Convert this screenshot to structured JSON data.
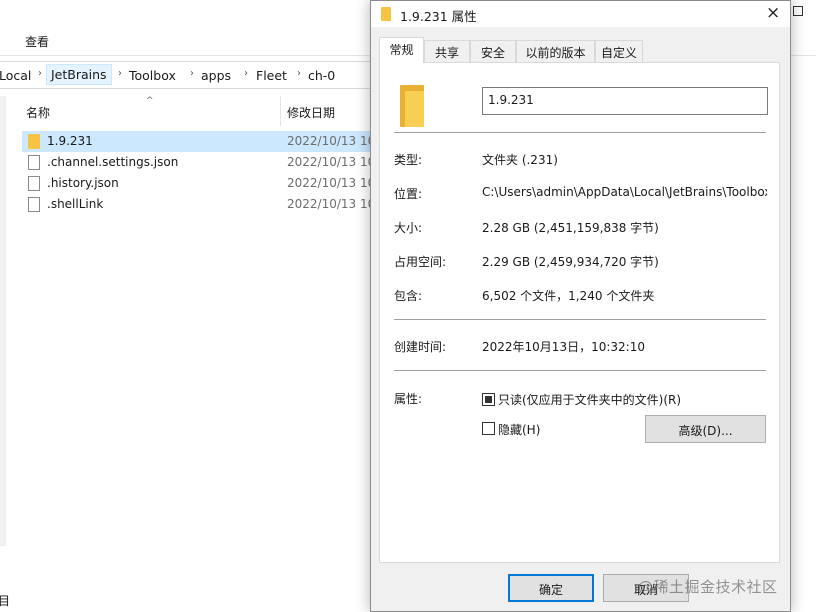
{
  "explorer": {
    "ribbon_tab": "查看",
    "breadcrumbs": [
      "Local",
      "JetBrains",
      "Toolbox",
      "apps",
      "Fleet",
      "ch-0"
    ],
    "columns": {
      "name": "名称",
      "modified": "修改日期"
    },
    "files": [
      {
        "name": "1.9.231",
        "date": "2022/10/13 10",
        "type": "folder",
        "selected": true
      },
      {
        "name": ".channel.settings.json",
        "date": "2022/10/13 10",
        "type": "json",
        "selected": false
      },
      {
        "name": ".history.json",
        "date": "2022/10/13 10",
        "type": "json",
        "selected": false
      },
      {
        "name": ".shellLink",
        "date": "2022/10/13 10",
        "type": "file",
        "selected": false
      }
    ],
    "status_glyph": "目"
  },
  "dialog": {
    "title": "1.9.231 属性",
    "close_label": "×",
    "tabs": [
      "常规",
      "共享",
      "安全",
      "以前的版本",
      "自定义"
    ],
    "active_tab": 0,
    "name_value": "1.9.231",
    "props": {
      "type": {
        "label": "类型:",
        "value": "文件夹 (.231)"
      },
      "location": {
        "label": "位置:",
        "value": "C:\\Users\\admin\\AppData\\Local\\JetBrains\\Toolbox"
      },
      "size": {
        "label": "大小:",
        "value": "2.28 GB (2,451,159,838 字节)"
      },
      "disk_size": {
        "label": "占用空间:",
        "value": "2.29 GB (2,459,934,720 字节)"
      },
      "contains": {
        "label": "包含:",
        "value": "6,502 个文件，1,240 个文件夹"
      },
      "created": {
        "label": "创建时间:",
        "value": "2022年10月13日，10:32:10"
      },
      "attributes": {
        "label": "属性:"
      }
    },
    "readonly_label": "只读(仅应用于文件夹中的文件)(R)",
    "readonly_state": "indeterminate",
    "hidden_label": "隐藏(H)",
    "hidden_checked": false,
    "advanced_button": "高级(D)...",
    "ok_button": "确定",
    "cancel_button": "取消"
  },
  "watermark": "@稀土掘金技术社区",
  "colors": {
    "selection": "#cce8ff",
    "accent": "#0078d7",
    "folder": "#f6c343"
  }
}
